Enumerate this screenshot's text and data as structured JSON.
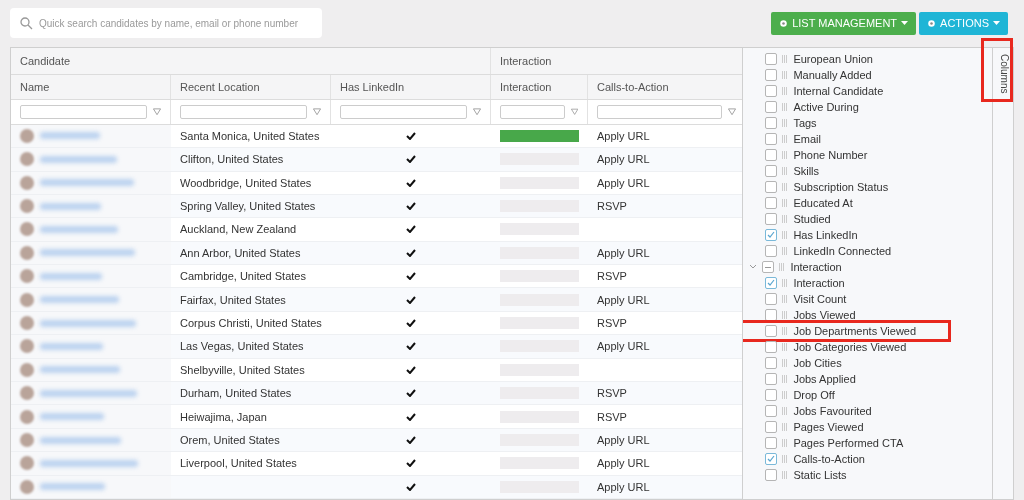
{
  "search": {
    "placeholder": "Quick search candidates by name, email or phone number"
  },
  "buttons": [
    {
      "label": "LIST MANAGEMENT",
      "kind": "success"
    },
    {
      "label": "ACTIONS",
      "kind": "info"
    }
  ],
  "table": {
    "groups": [
      {
        "label": "Candidate"
      },
      {
        "label": "Interaction"
      }
    ],
    "columns": [
      "Name",
      "Recent Location",
      "Has LinkedIn",
      "Interaction",
      "Calls-to-Action"
    ],
    "rows": [
      {
        "location": "Santa Monica, United States",
        "has_linkedin": true,
        "level": 1,
        "cta": "Apply URL"
      },
      {
        "location": "Clifton, United States",
        "has_linkedin": true,
        "level": 0,
        "cta": "Apply URL"
      },
      {
        "location": "Woodbridge, United States",
        "has_linkedin": true,
        "level": 0,
        "cta": "Apply URL"
      },
      {
        "location": "Spring Valley, United States",
        "has_linkedin": true,
        "level": 0,
        "cta": "RSVP"
      },
      {
        "location": "Auckland, New Zealand",
        "has_linkedin": true,
        "level": 0
      },
      {
        "location": "Ann Arbor, United States",
        "has_linkedin": true,
        "level": 0,
        "cta": "Apply URL"
      },
      {
        "location": "Cambridge, United States",
        "has_linkedin": true,
        "level": 0,
        "cta": "RSVP"
      },
      {
        "location": "Fairfax, United States",
        "has_linkedin": true,
        "level": 0,
        "cta": "Apply URL"
      },
      {
        "location": "Corpus Christi, United States",
        "has_linkedin": true,
        "level": 0,
        "cta": "RSVP"
      },
      {
        "location": "Las Vegas, United States",
        "has_linkedin": true,
        "level": 0,
        "cta": "Apply URL"
      },
      {
        "location": "Shelbyville, United States",
        "has_linkedin": true,
        "level": 0
      },
      {
        "location": "Durham, United States",
        "has_linkedin": true,
        "level": 0,
        "cta": "RSVP"
      },
      {
        "location": "Heiwajima, Japan",
        "has_linkedin": true,
        "level": 0,
        "cta": "RSVP"
      },
      {
        "location": "Orem, United States",
        "has_linkedin": true,
        "level": 0,
        "cta": "Apply URL"
      },
      {
        "location": "Liverpool, United States",
        "has_linkedin": true,
        "level": 0,
        "cta": "Apply URL"
      },
      {
        "has_linkedin": true,
        "level": 0,
        "cta": "Apply URL"
      }
    ]
  },
  "columns_panel": {
    "tab": {
      "label": "Columns",
      "highlighted": true
    },
    "items": [
      {
        "kind": "column",
        "label": "European Union",
        "checked": false
      },
      {
        "kind": "column",
        "label": "Manually Added",
        "checked": false
      },
      {
        "kind": "column",
        "label": "Internal Candidate",
        "checked": false
      },
      {
        "kind": "column",
        "label": "Active During",
        "checked": false
      },
      {
        "kind": "column",
        "label": "Tags",
        "checked": false
      },
      {
        "kind": "column",
        "label": "Email",
        "checked": false
      },
      {
        "kind": "column",
        "label": "Phone Number",
        "checked": false
      },
      {
        "kind": "column",
        "label": "Skills",
        "checked": false
      },
      {
        "kind": "column",
        "label": "Subscription Status",
        "checked": false
      },
      {
        "kind": "column",
        "label": "Educated At",
        "checked": false
      },
      {
        "kind": "column",
        "label": "Studied",
        "checked": false
      },
      {
        "kind": "column",
        "label": "Has LinkedIn",
        "checked": true
      },
      {
        "kind": "column",
        "label": "LinkedIn Connected",
        "checked": false
      },
      {
        "kind": "group",
        "label": "Interaction",
        "expanded": true,
        "partial": true,
        "children": [
          {
            "kind": "column",
            "label": "Interaction",
            "checked": true
          },
          {
            "kind": "column",
            "label": "Visit Count",
            "checked": false
          },
          {
            "kind": "column",
            "label": "Jobs Viewed",
            "checked": false
          },
          {
            "kind": "column",
            "label": "Job Departments Viewed",
            "checked": false,
            "highlighted": true
          },
          {
            "kind": "column",
            "label": "Job Categories Viewed",
            "checked": false
          },
          {
            "kind": "column",
            "label": "Job Cities",
            "checked": false
          },
          {
            "kind": "column",
            "label": "Jobs Applied",
            "checked": false
          },
          {
            "kind": "column",
            "label": "Drop Off",
            "checked": false
          },
          {
            "kind": "column",
            "label": "Jobs Favourited",
            "checked": false
          },
          {
            "kind": "column",
            "label": "Pages Viewed",
            "checked": false
          },
          {
            "kind": "column",
            "label": "Pages Performed CTA",
            "checked": false
          },
          {
            "kind": "column",
            "label": "Calls-to-Action",
            "checked": true
          },
          {
            "kind": "column",
            "label": "Static Lists",
            "checked": false
          }
        ]
      }
    ]
  }
}
